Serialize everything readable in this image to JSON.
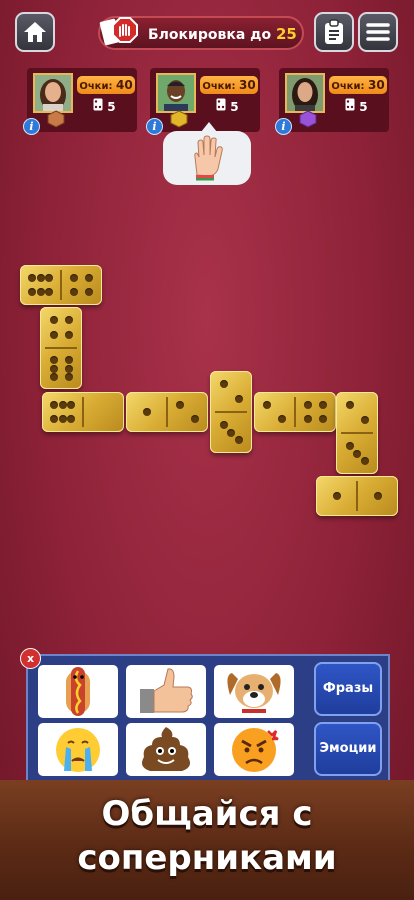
{
  "header": {
    "home_icon": "home-icon",
    "rules_icon": "clipboard-icon",
    "menu_icon": "menu-icon",
    "mode_label": "Блокировка до",
    "mode_target": "25"
  },
  "players": [
    {
      "score_label": "Очки:",
      "score": "40",
      "tiles_left": "5",
      "gem": "bronze-gem",
      "gem_color": "#c87a48"
    },
    {
      "score_label": "Очки:",
      "score": "30",
      "tiles_left": "5",
      "gem": "gold-gem",
      "gem_color": "#e3b52a"
    },
    {
      "score_label": "Очки:",
      "score": "30",
      "tiles_left": "5",
      "gem": "purple-gem",
      "gem_color": "#9a52d8"
    }
  ],
  "info_glyph": "i",
  "emoji_panel": {
    "close_label": "x",
    "phrases_label": "Фразы",
    "emotions_label": "Эмоции",
    "emojis": [
      "hotdog",
      "thumbs-up",
      "dog",
      "crying-face",
      "poop",
      "angry-face"
    ]
  },
  "promo": {
    "line1": "Общайся с",
    "line2": "соперниками"
  },
  "colors": {
    "score_badge": "#f6a22c",
    "panel": "#2c3f86",
    "accent_number": "#ffcb2e"
  }
}
